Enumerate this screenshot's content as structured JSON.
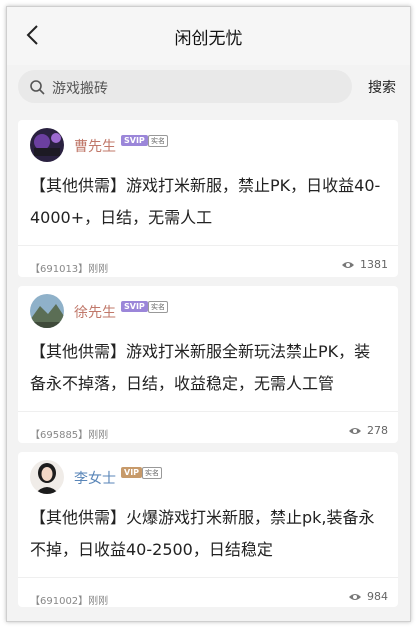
{
  "header": {
    "title": "闲创无忧"
  },
  "search": {
    "placeholder": "游戏搬砖",
    "button_label": "搜索"
  },
  "posts": [
    {
      "name": "曹先生",
      "vip": "SVIP",
      "verified": "实名",
      "content": "【其他供需】游戏打米新服，禁止PK，日收益40-4000+，日结，无需人工",
      "meta": "【691013】刚刚",
      "views": "1381"
    },
    {
      "name": "徐先生",
      "vip": "SVIP",
      "verified": "实名",
      "content": "【其他供需】游戏打米新服全新玩法禁止PK，装备永不掉落，日结，收益稳定，无需人工管",
      "meta": "【695885】刚刚",
      "views": "278"
    },
    {
      "name": "李女士",
      "vip": "VIP",
      "verified": "实名",
      "content": "【其他供需】火爆游戏打米新服，禁止pk,装备永不掉，日收益40-2500，日结稳定",
      "meta": "【691002】刚刚",
      "views": "984"
    }
  ],
  "colors": {
    "name_male": "#c0786a",
    "name_female": "#5a86b8",
    "svip": "#9b86d9",
    "vip": "#c79a6a"
  }
}
